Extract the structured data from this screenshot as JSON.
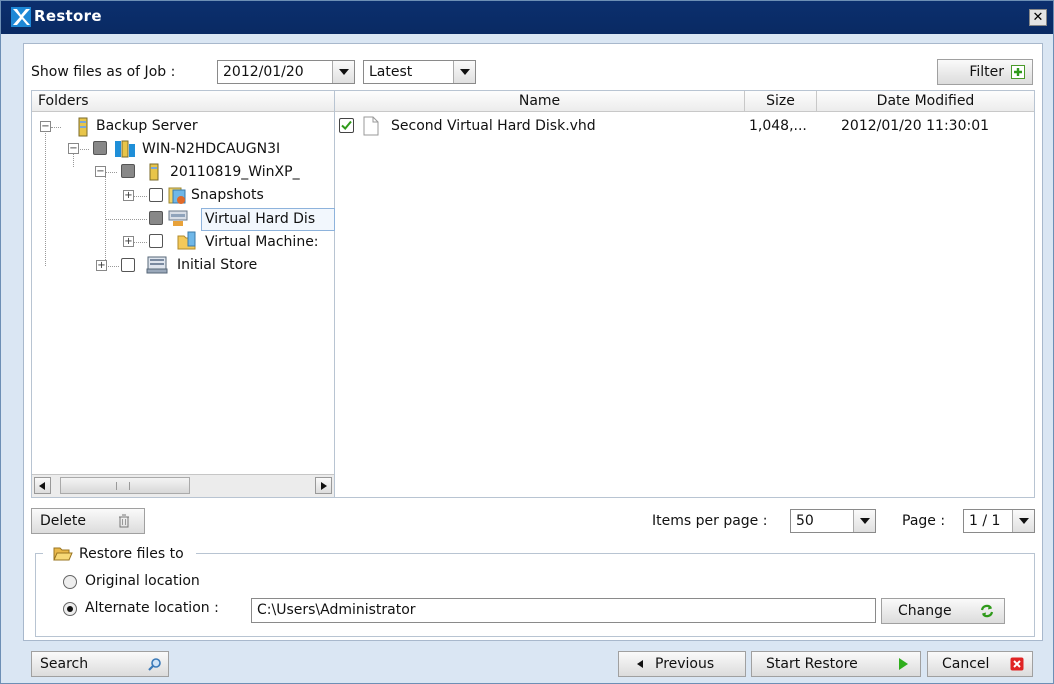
{
  "window": {
    "title": "Restore",
    "close": "✕"
  },
  "toolbar": {
    "show_label": "Show files as of Job :",
    "job_value": "2012/01/20",
    "version_value": "Latest",
    "filter_label": "Filter"
  },
  "folders": {
    "header": "Folders",
    "tree": {
      "root": "Backup Server",
      "server": "WIN-N2HDCAUGN3I",
      "job": "20110819_WinXP_",
      "snapshots": "Snapshots",
      "vhd": "Virtual Hard Dis",
      "vm": "Virtual Machine:",
      "initial": "Initial Store"
    }
  },
  "files": {
    "columns": {
      "name": "Name",
      "size": "Size",
      "date": "Date Modified"
    },
    "rows": [
      {
        "name": "Second Virtual Hard Disk.vhd",
        "size": "1,048,...",
        "date": "2012/01/20 11:30:01",
        "checked": true
      }
    ]
  },
  "footer_bar": {
    "delete_label": "Delete",
    "items_per_page_label": "Items per page :",
    "items_per_page_value": "50",
    "page_label": "Page :",
    "page_value": "1 / 1"
  },
  "restore_to": {
    "legend": "Restore files to",
    "original_label": "Original location",
    "alternate_label": "Alternate location :",
    "alternate_path": "C:\\Users\\Administrator",
    "change_label": "Change",
    "selected": "alternate"
  },
  "bottom": {
    "search_label": "Search",
    "previous_label": "Previous",
    "start_label": "Start Restore",
    "cancel_label": "Cancel"
  }
}
